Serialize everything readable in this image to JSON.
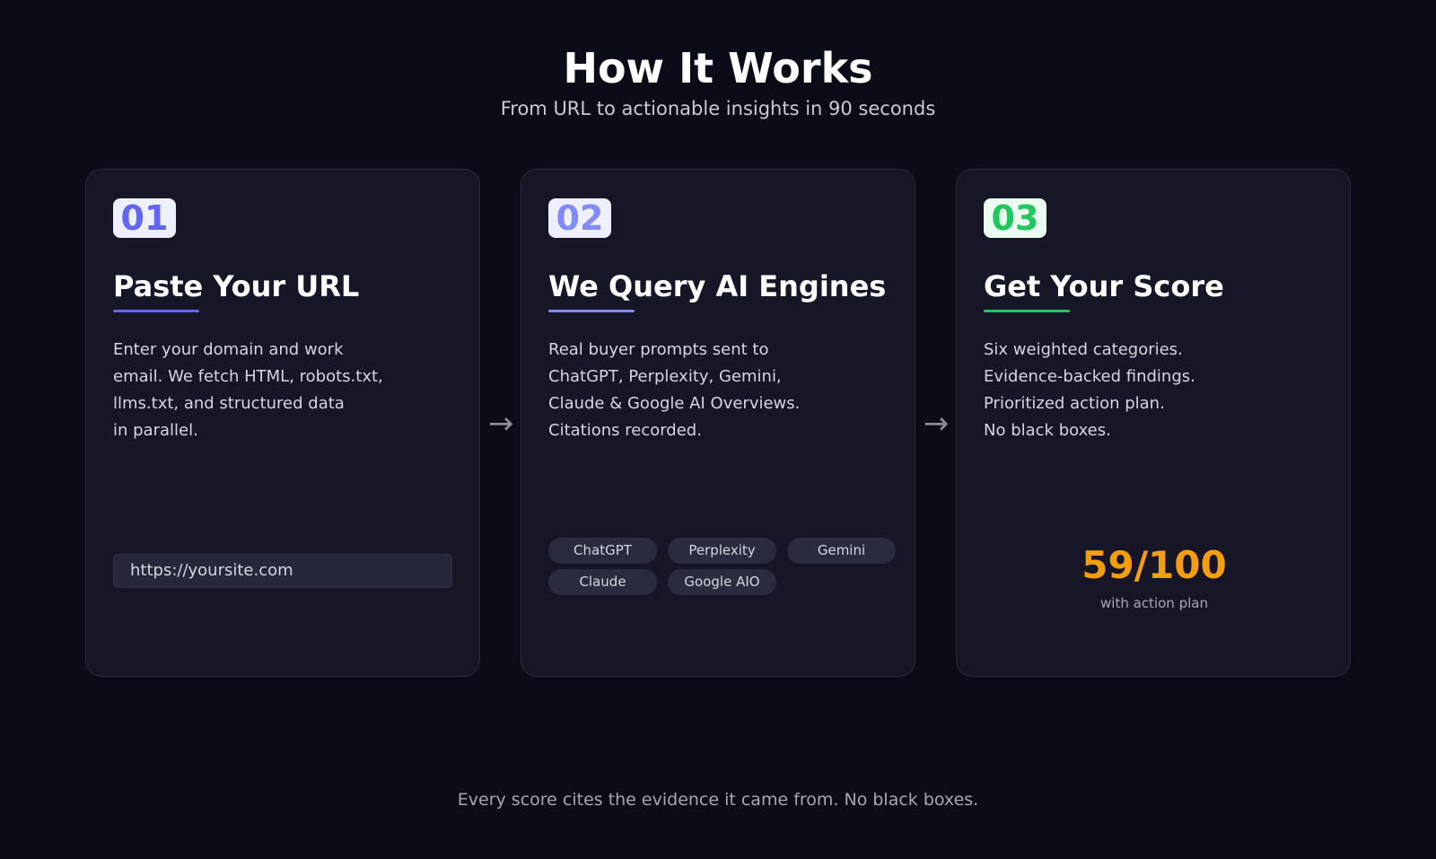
{
  "header": {
    "title": "How It Works",
    "subtitle": "From URL to actionable insights in 90 seconds"
  },
  "steps": [
    {
      "number": "01",
      "title": "Paste Your URL",
      "description_lines": [
        "Enter your domain and work",
        "email. We fetch HTML, robots.txt,",
        "llms.txt, and structured data",
        "in parallel."
      ],
      "url_value": "https://yoursite.com",
      "accent": "#6366f1"
    },
    {
      "number": "02",
      "title": "We Query AI Engines",
      "description_lines": [
        "Real buyer prompts sent to",
        "ChatGPT, Perplexity, Gemini,",
        "Claude & Google AI Overviews.",
        "Citations recorded."
      ],
      "engines": [
        "ChatGPT",
        "Perplexity",
        "Gemini",
        "Claude",
        "Google AIO"
      ],
      "accent": "#818cf8"
    },
    {
      "number": "03",
      "title": "Get Your Score",
      "description_lines": [
        "Six weighted categories.",
        "Evidence-backed findings.",
        "Prioritized action plan.",
        "No black boxes."
      ],
      "score": "59/100",
      "score_caption": "with action plan",
      "accent": "#22c55e",
      "score_color": "#f59e0b"
    }
  ],
  "arrow_glyph": "→",
  "footer": "Every score cites the evidence it came from. No black boxes."
}
